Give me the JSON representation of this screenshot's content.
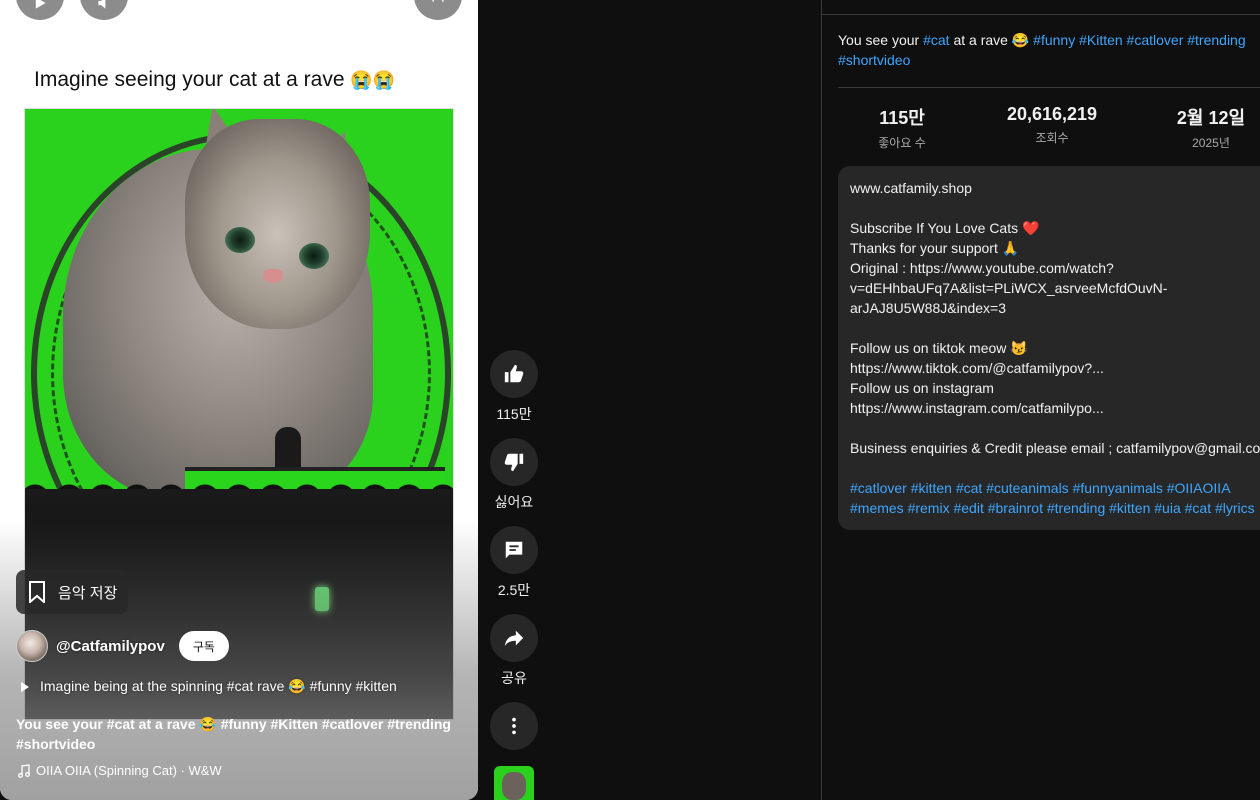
{
  "player": {
    "title": "Imagine seeing your cat at a rave",
    "title_emoji": "😭😭",
    "save_music_label": "음악 저장",
    "channel_handle": "@Catfamilypov",
    "subscribe_label": "구독",
    "music_line": "Imagine being at the spinning #cat rave 😂  #funny #kitten",
    "overlay_desc": "You see your #cat at a rave 😂 #funny #Kitten #catlover #trending #shortvideo",
    "audio_track": "OIIA OIIA (Spinning Cat) · W&W"
  },
  "rail": {
    "like_count": "115만",
    "dislike_label": "싫어요",
    "comment_count": "2.5만",
    "share_label": "공유"
  },
  "panel": {
    "desc_text": "You see your",
    "desc_tag_cat": "#cat",
    "desc_mid": "at a rave 😂",
    "desc_tags_1": "#funny #Kitten #catlover #trending",
    "desc_tags_2": "#shortvideo",
    "stats": [
      {
        "value": "115만",
        "label": "좋아요 수"
      },
      {
        "value": "20,616,219",
        "label": "조회수"
      },
      {
        "value": "2월 12일",
        "label": "2025년"
      }
    ],
    "description_lines": [
      "www.catfamily.shop",
      "",
      "Subscribe If You Love Cats ❤️",
      "Thanks for your support 🙏",
      "Original : https://www.youtube.com/watch?",
      "v=dEHhbaUFq7A&list=PLiWCX_asrveeMcfdOuvN-",
      "arJAJ8U5W88J&index=3",
      "",
      "Follow us on tiktok meow 😼",
      "https://www.tiktok.com/@catfamilypov?...",
      "Follow us on instagram",
      "https://www.instagram.com/catfamilypo...",
      "",
      "Business enquiries & Credit please email ; catfamilypov@gmail.com"
    ],
    "hashtag_line_1": "#catlover #kitten #cat #cuteanimals #funnyanimals #OIIAOIIA",
    "hashtag_line_2": "#memes #remix #edit #brainrot #trending #kitten #uia #cat #lyrics"
  },
  "colors": {
    "page_bg": "#0f0f0f",
    "card_bg": "#272727",
    "link_blue": "#3ea6ff",
    "video_green": "#2ad11d"
  },
  "icons": [
    "play-icon",
    "volume-icon",
    "fullscreen-icon",
    "bookmark-icon",
    "thumb-up-icon",
    "thumb-down-icon",
    "comment-icon",
    "share-icon",
    "more-icon",
    "music-note-icon"
  ]
}
